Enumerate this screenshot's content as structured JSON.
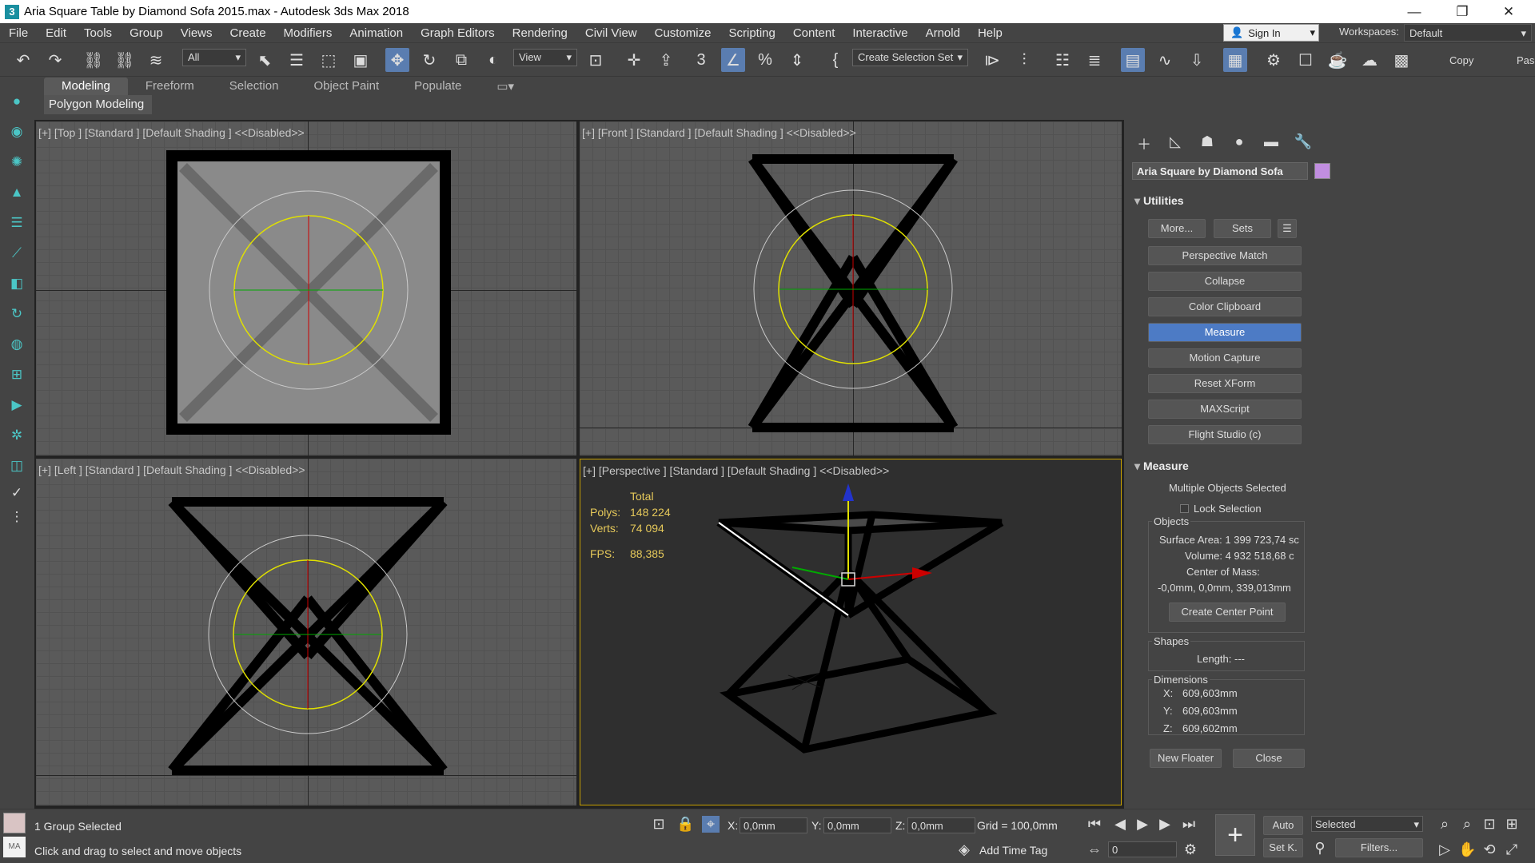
{
  "window": {
    "title": "Aria Square Table by Diamond Sofa 2015.max - Autodesk 3ds Max 2018"
  },
  "menu": [
    "File",
    "Edit",
    "Tools",
    "Group",
    "Views",
    "Create",
    "Modifiers",
    "Animation",
    "Graph Editors",
    "Rendering",
    "Civil View",
    "Customize",
    "Scripting",
    "Content",
    "Interactive",
    "Arnold",
    "Help"
  ],
  "account": {
    "signin": "Sign In",
    "workspaces_label": "Workspaces:",
    "workspace": "Default"
  },
  "toolbar": {
    "filter": "All",
    "ref_coord": "View",
    "selection_set": "Create Selection Set",
    "copy": "Copy",
    "paste": "Pas"
  },
  "ribbon": {
    "tabs": [
      "Modeling",
      "Freeform",
      "Selection",
      "Object Paint",
      "Populate"
    ],
    "sub": "Polygon Modeling"
  },
  "viewports": {
    "top": "[+] [Top ] [Standard ] [Default Shading ] <<Disabled>>",
    "front": "[+] [Front ] [Standard ] [Default Shading ] <<Disabled>>",
    "left": "[+] [Left ] [Standard ] [Default Shading ] <<Disabled>>",
    "persp": "[+] [Perspective ] [Standard ] [Default Shading ] <<Disabled>>",
    "stats": {
      "total": "Total",
      "polys_label": "Polys:",
      "polys": "148 224",
      "verts_label": "Verts:",
      "verts": "74 094",
      "fps_label": "FPS:",
      "fps": "88,385"
    }
  },
  "panel": {
    "object_name": "Aria Square by Diamond Sofa",
    "object_color": "#c18ee0",
    "utilities_title": "Utilities",
    "more": "More...",
    "sets": "Sets",
    "utilities": [
      "Perspective Match",
      "Collapse",
      "Color Clipboard",
      "Measure",
      "Motion Capture",
      "Reset XForm",
      "MAXScript",
      "Flight Studio (c)"
    ],
    "active_utility": "Measure",
    "measure_title": "Measure",
    "multi": "Multiple Objects Selected",
    "lock": "Lock Selection",
    "objects_label": "Objects",
    "surface_area": "Surface Area:  1 399 723,74 sc",
    "volume": "Volume:  4 932 518,68 c",
    "center_mass_label": "Center of Mass:",
    "center_mass": "-0,0mm, 0,0mm, 339,013mm",
    "center_point_btn": "Create Center Point",
    "shapes_label": "Shapes",
    "length": "Length:  ---",
    "dimensions_label": "Dimensions",
    "dim_x_label": "X:",
    "dim_x": "609,603mm",
    "dim_y_label": "Y:",
    "dim_y": "609,603mm",
    "dim_z_label": "Z:",
    "dim_z": "609,602mm",
    "new_floater": "New Floater",
    "close": "Close"
  },
  "status": {
    "selected": "1 Group Selected",
    "prompt": "Click and drag to select and move objects",
    "maxscript": "MA",
    "x_label": "X:",
    "x": "0,0mm",
    "y_label": "Y:",
    "y": "0,0mm",
    "z_label": "Z:",
    "z": "0,0mm",
    "grid": "Grid = 100,0mm",
    "add_time_tag": "Add Time Tag",
    "frame": "0",
    "auto": "Auto",
    "setk": "Set K.",
    "key_mode": "Selected",
    "filters": "Filters..."
  }
}
